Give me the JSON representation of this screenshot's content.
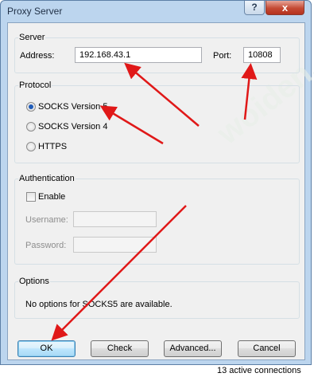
{
  "window": {
    "title": "Proxy Server",
    "help_label": "?",
    "close_label": "x"
  },
  "server": {
    "group_label": "Server",
    "address_label": "Address:",
    "address_value": "192.168.43.1",
    "port_label": "Port:",
    "port_value": "10808"
  },
  "protocol": {
    "group_label": "Protocol",
    "options": [
      {
        "label": "SOCKS Version 5",
        "selected": true
      },
      {
        "label": "SOCKS Version 4",
        "selected": false
      },
      {
        "label": "HTTPS",
        "selected": false
      }
    ]
  },
  "authentication": {
    "group_label": "Authentication",
    "enable_label": "Enable",
    "enable_checked": false,
    "username_label": "Username:",
    "username_value": "",
    "password_label": "Password:",
    "password_value": ""
  },
  "options": {
    "group_label": "Options",
    "message": "No options for SOCKS5 are available."
  },
  "buttons": {
    "ok": "OK",
    "check": "Check",
    "advanced": "Advanced...",
    "cancel": "Cancel"
  },
  "statusbar": {
    "text": "13 active connections"
  },
  "watermark": {
    "text": "woiden.com"
  },
  "colors": {
    "annotation_arrow": "#e01818",
    "title_bar": "#bcd5ee",
    "close_button": "#c44a34"
  }
}
